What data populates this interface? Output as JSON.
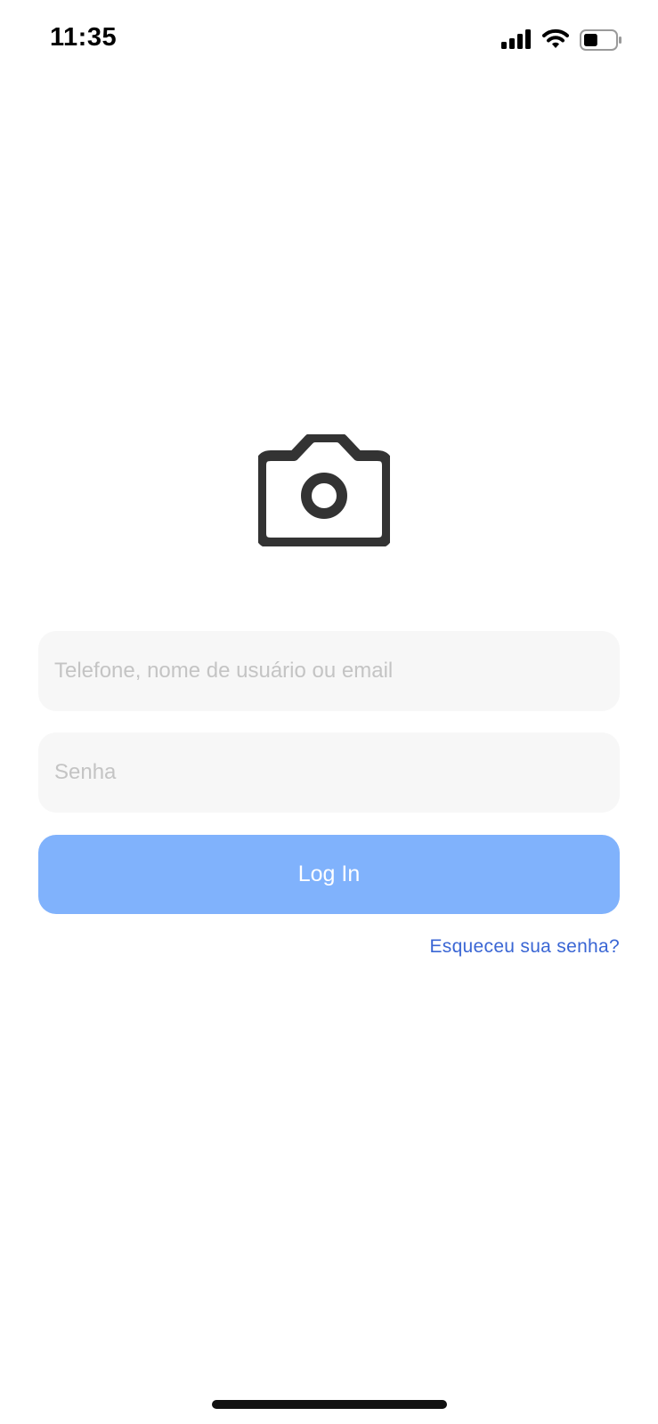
{
  "status_bar": {
    "time": "11:35",
    "icons": [
      "signal-icon",
      "wifi-icon",
      "battery-icon"
    ],
    "battery_level": 0.45
  },
  "logo": {
    "icon": "camera-icon",
    "color": "#333333"
  },
  "login_form": {
    "username_placeholder": "Telefone, nome de usuário ou email",
    "username_value": "",
    "password_placeholder": "Senha",
    "password_value": "",
    "login_label": "Log In",
    "forgot_label": "Esqueceu sua senha?"
  },
  "colors": {
    "button": "#80b2fc",
    "link": "#3a66d4",
    "field_background": "#f7f7f7",
    "placeholder": "#c4c4c4"
  }
}
